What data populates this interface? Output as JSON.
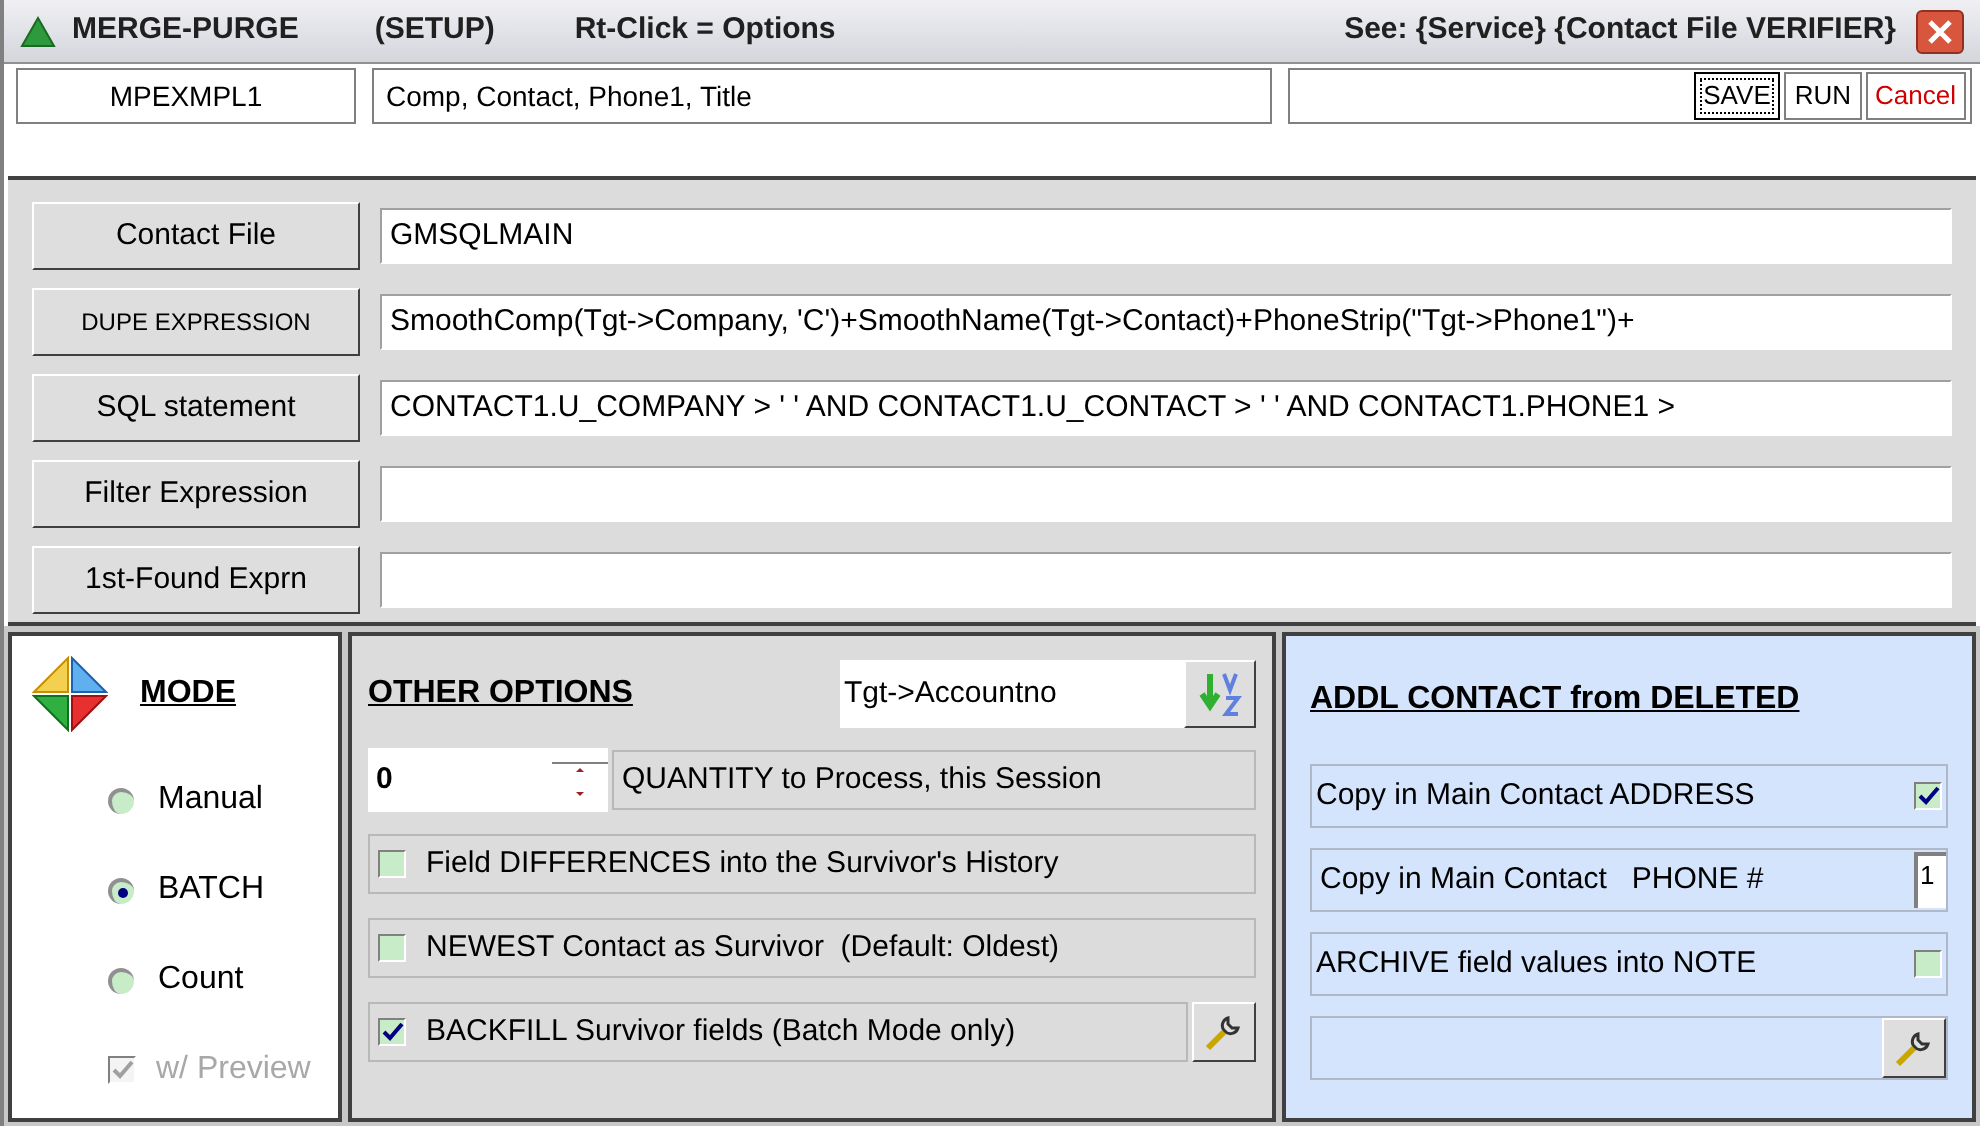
{
  "window": {
    "title_parts": [
      "MERGE-PURGE",
      "(SETUP)",
      "Rt-Click = Options",
      "See: {Service} {Contact File VERIFIER}"
    ]
  },
  "header": {
    "name": "MPEXMPL1",
    "fields": "Comp, Contact, Phone1, Title",
    "buttons": [
      {
        "label": "SAVE",
        "focused": true,
        "kind": "normal"
      },
      {
        "label": "RUN",
        "focused": false,
        "kind": "normal"
      },
      {
        "label": "Cancel",
        "focused": false,
        "kind": "cancel"
      }
    ]
  },
  "expressions": [
    {
      "label": "Contact File",
      "value": "GMSQLMAIN"
    },
    {
      "label": "DUPE EXPRESSION",
      "value": "SmoothComp(Tgt->Company, 'C')+SmoothName(Tgt->Contact)+PhoneStrip(\"Tgt->Phone1\")+"
    },
    {
      "label": "SQL statement",
      "value": "CONTACT1.U_COMPANY > ' ' AND CONTACT1.U_CONTACT > ' ' AND CONTACT1.PHONE1 >"
    },
    {
      "label": "Filter Expression"
    },
    {
      "label": "1st-Found Exprn"
    }
  ],
  "mode": {
    "title": "MODE",
    "options": [
      {
        "label": "Manual",
        "selected": false
      },
      {
        "label": "BATCH",
        "selected": true
      },
      {
        "label": "Count",
        "selected": false
      }
    ],
    "preview": {
      "label": "w/ Preview",
      "checked": true,
      "disabled": true
    }
  },
  "other_options": {
    "title": "OTHER OPTIONS",
    "sort_field": "Tgt->Accountno",
    "quantity": {
      "value": "0",
      "label": "QUANTITY to Process, this Session"
    },
    "options": [
      {
        "label": "Field DIFFERENCES into the Survivor's History",
        "checked": false,
        "has_tool": false
      },
      {
        "label": "NEWEST Contact as Survivor  (Default: Oldest)",
        "checked": false,
        "has_tool": false
      },
      {
        "label": "BACKFILL Survivor fields (Batch Mode only)",
        "checked": true,
        "has_tool": true
      }
    ]
  },
  "addl_contact": {
    "title": "ADDL CONTACT from DELETED",
    "rows": [
      {
        "kind": "checkbox",
        "label": "Copy in Main Contact ADDRESS",
        "checked": true
      },
      {
        "kind": "number",
        "label": "Copy in Main Contact   PHONE #",
        "value": "1"
      },
      {
        "kind": "checkbox",
        "label": "ARCHIVE field values into NOTE",
        "checked": false
      },
      {
        "kind": "tool"
      }
    ]
  }
}
